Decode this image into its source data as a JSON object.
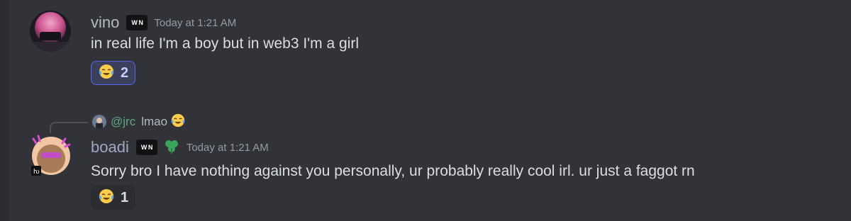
{
  "messages": [
    {
      "username": "vino",
      "badge": "W N",
      "timestamp": "Today at 1:21 AM",
      "text": "in real life I'm a boy but in web3 I'm a girl",
      "reaction": {
        "emoji": "tears-of-joy",
        "count": "2"
      }
    },
    {
      "reply": {
        "mention": "@jrc",
        "text": "lmao"
      },
      "username": "boadi",
      "badge": "W N",
      "timestamp": "Today at 1:21 AM",
      "text": "Sorry bro I have nothing against you personally, ur probably really cool irl. ur just a faggot rn",
      "reaction": {
        "emoji": "tears-of-joy",
        "count": "1"
      }
    }
  ],
  "colors": {
    "background": "#313338",
    "accent": "#5865f2",
    "mention": "#5ea880",
    "timestamp": "#949ba4"
  }
}
